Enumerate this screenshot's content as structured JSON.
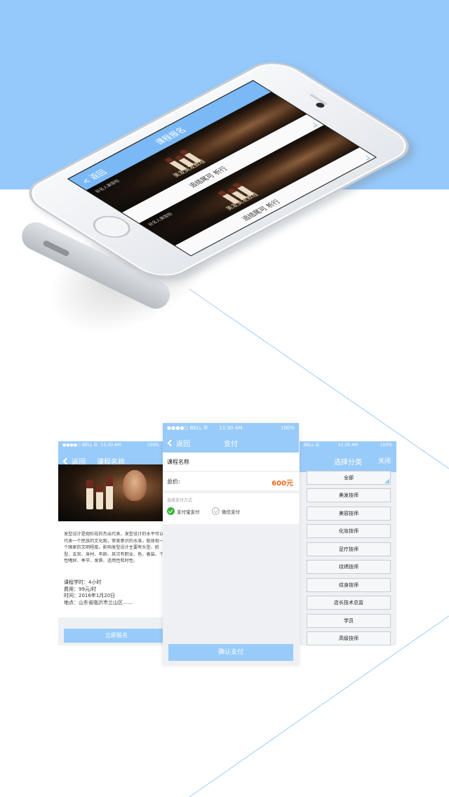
{
  "colors": {
    "accent": "#99cbfa",
    "background_band": "#95c9fb",
    "price": "#e66a1e",
    "check": "#38b33a"
  },
  "mockup_phone": {
    "nav": {
      "back_label": "返回",
      "title": "课程报名"
    },
    "cards": [
      {
        "brand": "好名人美容标",
        "slogan": "美发美发教程",
        "label": "追结尾可 析行"
      },
      {
        "brand": "好名人美容标",
        "slogan": "美发美发教程",
        "label": "追结尾可 析行"
      }
    ]
  },
  "left_screen": {
    "status": {
      "carrier": "●●●●○ BELL ☰",
      "time": "11:30 AM",
      "battery": "100%"
    },
    "nav": {
      "back_label": "返回",
      "title": "课程名称"
    },
    "description": "发型设计是观阶段的杰出代表，发型设计的水平可以代表一个民族的文化观，审美意识的水准，能体现一个国家的文明程度。影响发型设计主要有头型、脸型、五官、身材、年龄、其次有职业、色、着装、个性嗜好、季节、发质、适用性和时性。",
    "info": [
      "课程学时：4小时",
      "费用：99元/时",
      "时间：2016年1月20日",
      "地点：山东省临沂市兰山区……"
    ],
    "cta_label": "立即报名"
  },
  "center_screen": {
    "status": {
      "carrier": "●●●●○ BELL ☰",
      "time": "11:30 AM",
      "battery": "100%"
    },
    "nav": {
      "back_label": "返回",
      "title": "支付"
    },
    "course_name": "课程名称",
    "total_label": "总价:",
    "total_value": "600元",
    "payment_header": "选择支付方式",
    "payment_options": [
      "支付宝支付",
      "微信支付"
    ],
    "selected_payment": "支付宝支付",
    "confirm_label": "确认支付"
  },
  "right_screen": {
    "status": {
      "carrier": "BELL ☰",
      "time": "11:30 AM",
      "battery": "100%"
    },
    "nav": {
      "title": "选择分类",
      "close_label": "关闭"
    },
    "categories": [
      "全部",
      "美发技师",
      "美容技师",
      "化妆技师",
      "足疗技师",
      "纹绣技师",
      "纹身技师",
      "店长技术总监",
      "学员",
      "高级技师"
    ],
    "selected_category": "全部"
  }
}
